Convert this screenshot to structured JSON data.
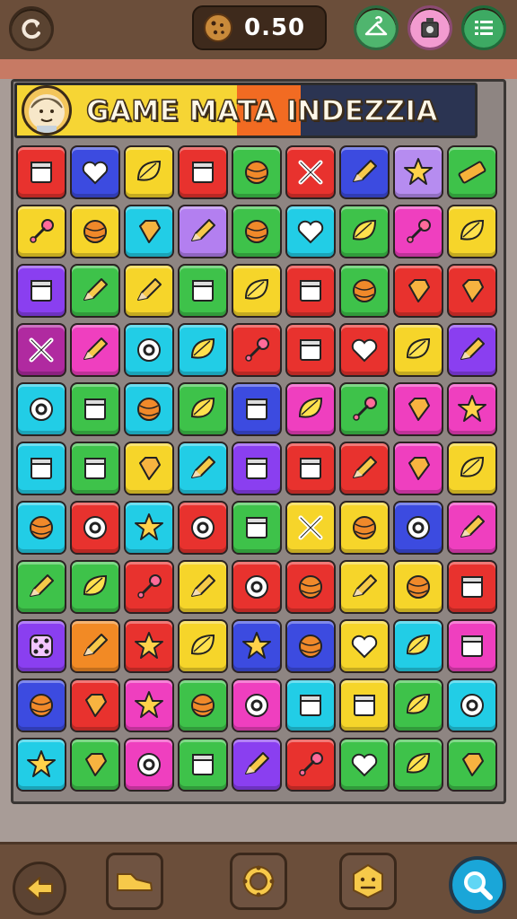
{
  "header": {
    "coins": "0.50",
    "buttons": {
      "refresh": "refresh-icon",
      "hanger": "hanger-icon",
      "robot": "robot-icon",
      "menu": "menu-list-icon"
    }
  },
  "banner": {
    "title": "GAME MATA INDEZZIA",
    "avatar": "portrait-icon"
  },
  "board": {
    "rows": [
      [
        {
          "c": "#e8322e",
          "i": "box"
        },
        {
          "c": "#3c4be0",
          "i": "heart"
        },
        {
          "c": "#f6d52a",
          "i": "leaf"
        },
        {
          "c": "#e8322e",
          "i": "box"
        },
        {
          "c": "#3ec24a",
          "i": "ball"
        },
        {
          "c": "#e8322e",
          "i": "cross"
        },
        {
          "c": "#3c4be0",
          "i": "pencil"
        },
        {
          "c": "#b68cf0",
          "i": "star"
        },
        {
          "c": "#3ec24a",
          "i": "bar"
        }
      ],
      [
        {
          "c": "#f6d52a",
          "i": "pin"
        },
        {
          "c": "#f6d52a",
          "i": "ball"
        },
        {
          "c": "#22cde6",
          "i": "gem"
        },
        {
          "c": "#b37ff0",
          "i": "pencil"
        },
        {
          "c": "#3ec24a",
          "i": "ball"
        },
        {
          "c": "#22cde6",
          "i": "heart"
        },
        {
          "c": "#3ec24a",
          "i": "leaf"
        },
        {
          "c": "#ef3fbf",
          "i": "pin"
        },
        {
          "c": "#f6d52a",
          "i": "leaf"
        }
      ],
      [
        {
          "c": "#8a3ff0",
          "i": "box"
        },
        {
          "c": "#3ec24a",
          "i": "pencil"
        },
        {
          "c": "#f6d52a",
          "i": "pencil"
        },
        {
          "c": "#3ec24a",
          "i": "box"
        },
        {
          "c": "#f6d52a",
          "i": "leaf"
        },
        {
          "c": "#e8322e",
          "i": "box"
        },
        {
          "c": "#3ec24a",
          "i": "ball"
        },
        {
          "c": "#e8322e",
          "i": "gem"
        },
        {
          "c": "#e8322e",
          "i": "gem"
        }
      ],
      [
        {
          "c": "#b02aa0",
          "i": "cross"
        },
        {
          "c": "#ef3fbf",
          "i": "pencil"
        },
        {
          "c": "#22cde6",
          "i": "ring"
        },
        {
          "c": "#22cde6",
          "i": "leaf"
        },
        {
          "c": "#e8322e",
          "i": "pin"
        },
        {
          "c": "#e8322e",
          "i": "box"
        },
        {
          "c": "#e8322e",
          "i": "heart"
        },
        {
          "c": "#f6d52a",
          "i": "leaf"
        },
        {
          "c": "#8a3ff0",
          "i": "pencil"
        }
      ],
      [
        {
          "c": "#22cde6",
          "i": "ring"
        },
        {
          "c": "#3ec24a",
          "i": "box"
        },
        {
          "c": "#22cde6",
          "i": "ball"
        },
        {
          "c": "#3ec24a",
          "i": "leaf"
        },
        {
          "c": "#3c4be0",
          "i": "box"
        },
        {
          "c": "#ef3fbf",
          "i": "leaf"
        },
        {
          "c": "#3ec24a",
          "i": "pin"
        },
        {
          "c": "#ef3fbf",
          "i": "gem"
        },
        {
          "c": "#ef3fbf",
          "i": "star"
        }
      ],
      [
        {
          "c": "#22cde6",
          "i": "box"
        },
        {
          "c": "#3ec24a",
          "i": "box"
        },
        {
          "c": "#f6d52a",
          "i": "gem"
        },
        {
          "c": "#22cde6",
          "i": "pencil"
        },
        {
          "c": "#8a3ff0",
          "i": "box"
        },
        {
          "c": "#e8322e",
          "i": "box"
        },
        {
          "c": "#e8322e",
          "i": "pencil"
        },
        {
          "c": "#ef3fbf",
          "i": "gem"
        },
        {
          "c": "#f6d52a",
          "i": "leaf"
        }
      ],
      [
        {
          "c": "#22cde6",
          "i": "ball"
        },
        {
          "c": "#e8322e",
          "i": "ring"
        },
        {
          "c": "#22cde6",
          "i": "star"
        },
        {
          "c": "#e8322e",
          "i": "ring"
        },
        {
          "c": "#3ec24a",
          "i": "box"
        },
        {
          "c": "#f6d52a",
          "i": "cross"
        },
        {
          "c": "#f6d52a",
          "i": "ball"
        },
        {
          "c": "#3c4be0",
          "i": "ring"
        },
        {
          "c": "#ef3fbf",
          "i": "pencil"
        }
      ],
      [
        {
          "c": "#3ec24a",
          "i": "pencil"
        },
        {
          "c": "#3ec24a",
          "i": "leaf"
        },
        {
          "c": "#e8322e",
          "i": "pin"
        },
        {
          "c": "#f6d52a",
          "i": "pencil"
        },
        {
          "c": "#e8322e",
          "i": "ring"
        },
        {
          "c": "#e8322e",
          "i": "ball"
        },
        {
          "c": "#f6d52a",
          "i": "pencil"
        },
        {
          "c": "#f6d52a",
          "i": "ball"
        },
        {
          "c": "#e8322e",
          "i": "box"
        }
      ],
      [
        {
          "c": "#8a3ff0",
          "i": "dice"
        },
        {
          "c": "#f28a25",
          "i": "pencil"
        },
        {
          "c": "#e8322e",
          "i": "star"
        },
        {
          "c": "#f6d52a",
          "i": "leaf"
        },
        {
          "c": "#3c4be0",
          "i": "star"
        },
        {
          "c": "#3c4be0",
          "i": "ball"
        },
        {
          "c": "#f6d52a",
          "i": "heart"
        },
        {
          "c": "#22cde6",
          "i": "leaf"
        },
        {
          "c": "#ef3fbf",
          "i": "box"
        }
      ],
      [
        {
          "c": "#3c4be0",
          "i": "ball"
        },
        {
          "c": "#e8322e",
          "i": "gem"
        },
        {
          "c": "#ef3fbf",
          "i": "star"
        },
        {
          "c": "#3ec24a",
          "i": "ball"
        },
        {
          "c": "#ef3fbf",
          "i": "ring"
        },
        {
          "c": "#22cde6",
          "i": "box"
        },
        {
          "c": "#f6d52a",
          "i": "box"
        },
        {
          "c": "#3ec24a",
          "i": "leaf"
        },
        {
          "c": "#22cde6",
          "i": "ring"
        }
      ],
      [
        {
          "c": "#22cde6",
          "i": "star"
        },
        {
          "c": "#3ec24a",
          "i": "gem"
        },
        {
          "c": "#ef3fbf",
          "i": "ring"
        },
        {
          "c": "#3ec24a",
          "i": "box"
        },
        {
          "c": "#8a3ff0",
          "i": "pencil"
        },
        {
          "c": "#e8322e",
          "i": "pin"
        },
        {
          "c": "#3ec24a",
          "i": "heart"
        },
        {
          "c": "#3ec24a",
          "i": "leaf"
        },
        {
          "c": "#3ec24a",
          "i": "gem"
        }
      ]
    ]
  },
  "footer": {
    "buttons": {
      "back": "arrow-left-icon",
      "shoe": "shoe-icon",
      "ring": "ring-icon",
      "face": "face-icon",
      "search": "magnifier-icon"
    }
  }
}
